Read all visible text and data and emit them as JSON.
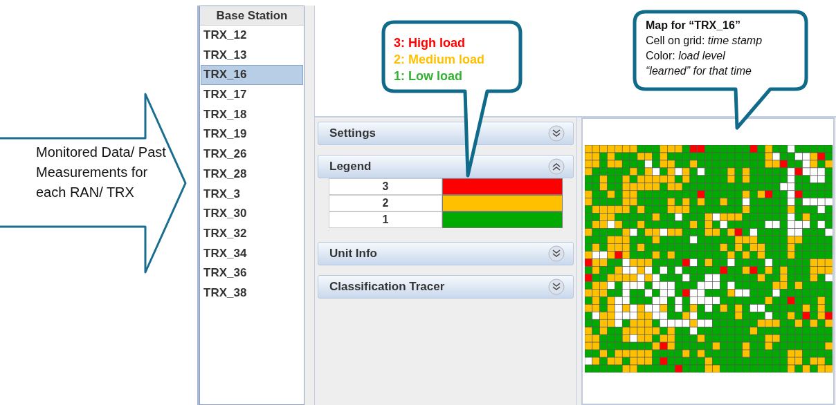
{
  "annotation_arrow": {
    "text": "Monitored Data/ Past Measurements for each RAN/ TRX"
  },
  "station_list": {
    "header": "Base Station",
    "items": [
      {
        "label": "TRX_12",
        "selected": false
      },
      {
        "label": "TRX_13",
        "selected": false
      },
      {
        "label": "TRX_16",
        "selected": true
      },
      {
        "label": "TRX_17",
        "selected": false
      },
      {
        "label": "TRX_18",
        "selected": false
      },
      {
        "label": "TRX_19",
        "selected": false
      },
      {
        "label": "TRX_26",
        "selected": false
      },
      {
        "label": "TRX_28",
        "selected": false
      },
      {
        "label": "TRX_3",
        "selected": false
      },
      {
        "label": "TRX_30",
        "selected": false
      },
      {
        "label": "TRX_32",
        "selected": false
      },
      {
        "label": "TRX_34",
        "selected": false
      },
      {
        "label": "TRX_36",
        "selected": false
      },
      {
        "label": "TRX_38",
        "selected": false
      }
    ]
  },
  "accordion": [
    {
      "title": "Settings",
      "expanded": false
    },
    {
      "title": "Legend",
      "expanded": true,
      "legend": [
        {
          "value": "3",
          "color": "#ff0000"
        },
        {
          "value": "2",
          "color": "#ffc000"
        },
        {
          "value": "1",
          "color": "#00aa00"
        }
      ]
    },
    {
      "title": "Unit Info",
      "expanded": false
    },
    {
      "title": "Classification Tracer",
      "expanded": false
    }
  ],
  "callouts": [
    {
      "kind": "legend",
      "lines": [
        {
          "text": "3: High load",
          "color": "#ff0000"
        },
        {
          "text": "2: Medium load",
          "color": "#ffc000"
        },
        {
          "text": "1: Low load",
          "color": "#33b033"
        }
      ]
    },
    {
      "kind": "map",
      "title": "Map for “TRX_16”",
      "lines": [
        {
          "text": "Cell on grid: *time stamp*",
          "italic": false
        },
        {
          "text": "Color: *load level*",
          "italic": false
        },
        {
          "text": "“learned” for that time",
          "italic": true
        }
      ]
    }
  ]
}
